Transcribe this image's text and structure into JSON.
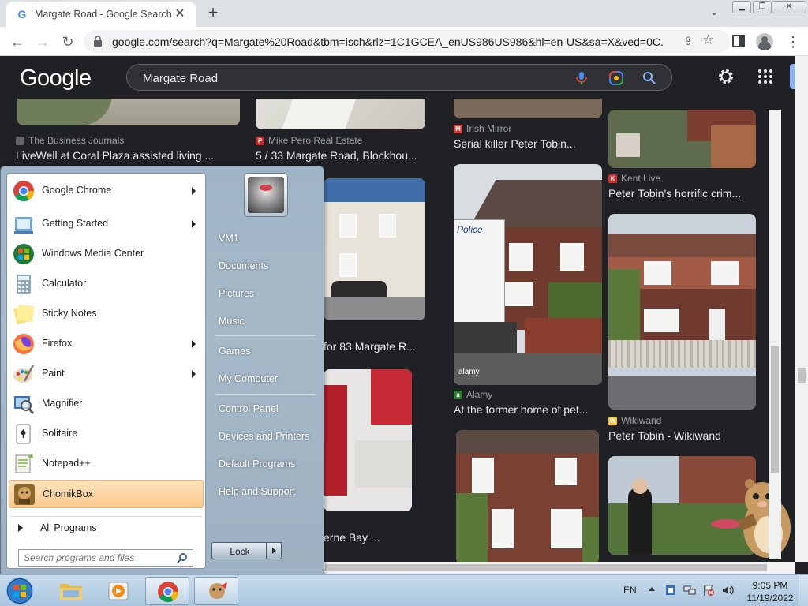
{
  "browser": {
    "tab_title": "Margate Road - Google Search",
    "url": "google.com/search?q=Margate%20Road&tbm=isch&rlz=1C1GCEA_enUS986US986&hl=en-US&sa=X&ved=0C...",
    "new_tab": "+",
    "tab_close": "✕"
  },
  "google": {
    "logo": "Google",
    "query": "Margate Road"
  },
  "results": [
    {
      "source": "The Business Journals",
      "caption": "LiveWell at Coral Plaza assisted living ...",
      "fav_color": "#5f6368",
      "fav_letter": ""
    },
    {
      "source": "Mike Pero Real Estate",
      "caption": "5 / 33 Margate Road, Blockhou...",
      "fav_color": "#c62828",
      "fav_letter": "P"
    },
    {
      "source": "Irish Mirror",
      "caption": "Serial killer Peter Tobin...",
      "fav_color": "#e53935",
      "fav_letter": "M"
    },
    {
      "source": "Kent Live",
      "caption": "Peter Tobin's horrific crim...",
      "fav_color": "#d32f2f",
      "fav_letter": "K"
    },
    {
      "source": "",
      "caption": "for 83 Margate R...",
      "fav_color": "",
      "fav_letter": ""
    },
    {
      "source": "Alamy",
      "caption": "At the former home of pet...",
      "fav_color": "#2e7d32",
      "fav_letter": "a"
    },
    {
      "source": "Wikiwand",
      "caption": "Peter Tobin - Wikiwand",
      "fav_color": "#fbc02d",
      "fav_letter": "W"
    },
    {
      "source": "",
      "caption": "erne Bay ...",
      "fav_color": "",
      "fav_letter": ""
    }
  ],
  "image_overlay_text": {
    "police": "Police",
    "alamy": "alamy"
  },
  "startmenu": {
    "programs": [
      {
        "label": "Google Chrome",
        "has_arrow": true
      },
      {
        "label": "Getting Started",
        "has_arrow": true
      },
      {
        "label": "Windows Media Center",
        "has_arrow": false
      },
      {
        "label": "Calculator",
        "has_arrow": false
      },
      {
        "label": "Sticky Notes",
        "has_arrow": false
      },
      {
        "label": "Firefox",
        "has_arrow": true
      },
      {
        "label": "Paint",
        "has_arrow": true
      },
      {
        "label": "Magnifier",
        "has_arrow": false
      },
      {
        "label": "Solitaire",
        "has_arrow": false
      },
      {
        "label": "Notepad++",
        "has_arrow": false
      },
      {
        "label": "ChomikBox",
        "has_arrow": false
      }
    ],
    "all_programs": "All Programs",
    "search_placeholder": "Search programs and files",
    "right_items": [
      "VM1",
      "Documents",
      "Pictures",
      "Music",
      "Games",
      "My Computer",
      "Control Panel",
      "Devices and Printers",
      "Default Programs",
      "Help and Support"
    ],
    "lock": "Lock"
  },
  "taskbar": {
    "language": "EN",
    "time": "9:05 PM",
    "date": "11/19/2022"
  }
}
